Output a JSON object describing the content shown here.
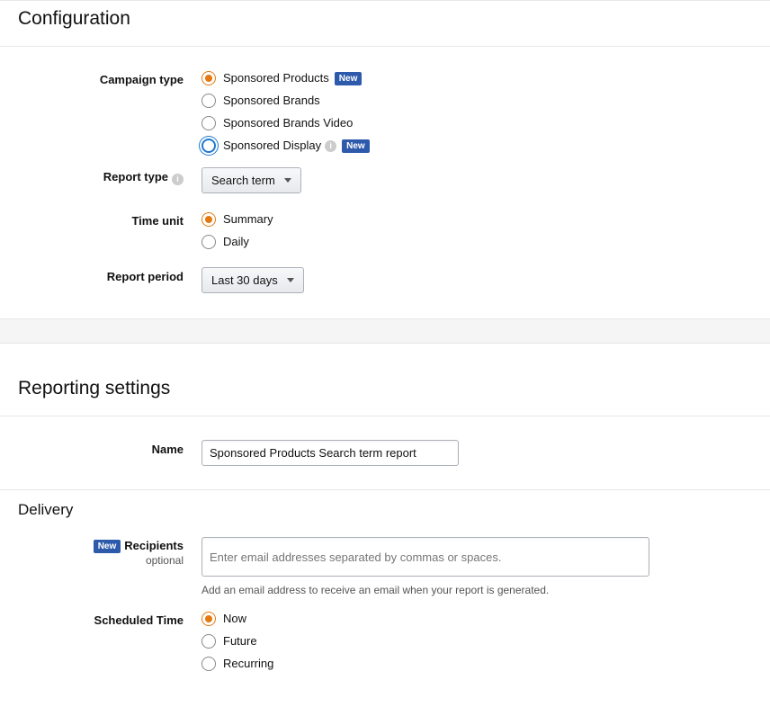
{
  "configuration": {
    "title": "Configuration",
    "campaign_type": {
      "label": "Campaign type",
      "options": [
        {
          "label": "Sponsored Products",
          "selected": true,
          "new": true
        },
        {
          "label": "Sponsored Brands",
          "selected": false,
          "new": false
        },
        {
          "label": "Sponsored Brands Video",
          "selected": false,
          "new": false
        },
        {
          "label": "Sponsored Display",
          "selected": false,
          "new": true,
          "info": true,
          "focus": true
        }
      ],
      "new_badge": "New"
    },
    "report_type": {
      "label": "Report type",
      "selected": "Search term"
    },
    "time_unit": {
      "label": "Time unit",
      "options": [
        {
          "label": "Summary",
          "selected": true
        },
        {
          "label": "Daily",
          "selected": false
        }
      ]
    },
    "report_period": {
      "label": "Report period",
      "selected": "Last 30 days"
    }
  },
  "reporting": {
    "title": "Reporting settings",
    "name": {
      "label": "Name",
      "value": "Sponsored Products Search term report"
    }
  },
  "delivery": {
    "title": "Delivery",
    "recipients": {
      "label": "Recipients",
      "optional": "optional",
      "new_badge": "New",
      "placeholder": "Enter email addresses separated by commas or spaces.",
      "hint": "Add an email address to receive an email when your report is generated."
    },
    "scheduled_time": {
      "label": "Scheduled Time",
      "options": [
        {
          "label": "Now",
          "selected": true
        },
        {
          "label": "Future",
          "selected": false
        },
        {
          "label": "Recurring",
          "selected": false
        }
      ]
    }
  }
}
